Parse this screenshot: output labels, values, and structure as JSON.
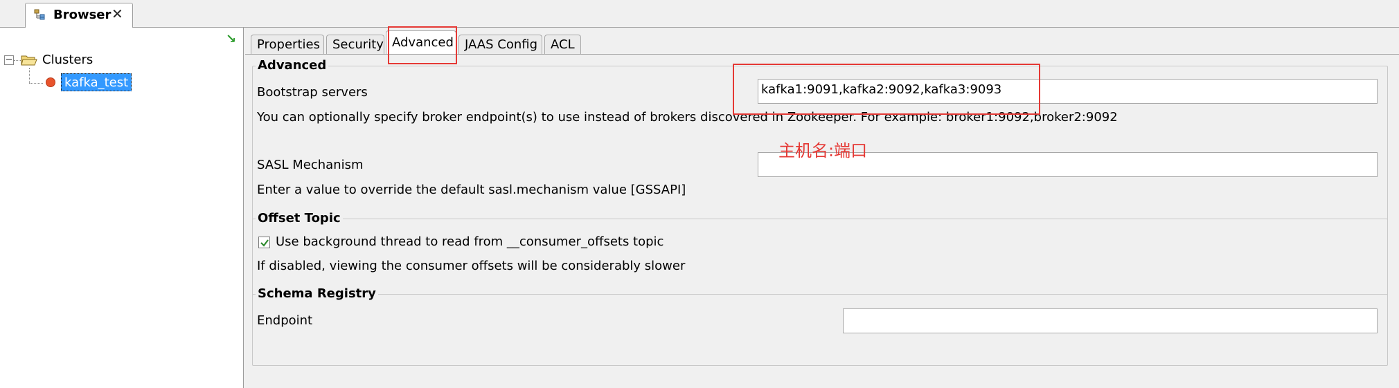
{
  "view": {
    "title": "Browser",
    "close_glyph": "✕",
    "icon": "browser-view-icon"
  },
  "tree": {
    "collapse_all_glyph": "↘",
    "toggle_glyph": "−",
    "root_label": "Clusters",
    "cluster_label": "kafka_test"
  },
  "tabs": [
    {
      "label": "Properties"
    },
    {
      "label": "Security"
    },
    {
      "label": "Advanced"
    },
    {
      "label": "JAAS Config"
    },
    {
      "label": "ACL"
    }
  ],
  "advanced": {
    "group_title": "Advanced",
    "bootstrap_label": "Bootstrap servers",
    "bootstrap_value": "kafka1:9091,kafka2:9092,kafka3:9093",
    "bootstrap_help": "You can optionally specify broker endpoint(s) to use instead of brokers discovered in Zookeeper. For example: broker1:9092,broker2:9092",
    "sasl_label": "SASL Mechanism",
    "sasl_value": "",
    "sasl_help": "Enter a value to override the default sasl.mechanism value [GSSAPI]"
  },
  "offset_topic": {
    "group_title": "Offset Topic",
    "checkbox_label": "Use background thread to read from __consumer_offsets topic",
    "checkbox_checked": true,
    "help": "If disabled, viewing the consumer offsets will be considerably slower"
  },
  "schema_registry": {
    "group_title": "Schema Registry",
    "endpoint_label": "Endpoint",
    "endpoint_value": ""
  },
  "annotation": {
    "text": "主机名:端口",
    "color": "#e53935"
  }
}
